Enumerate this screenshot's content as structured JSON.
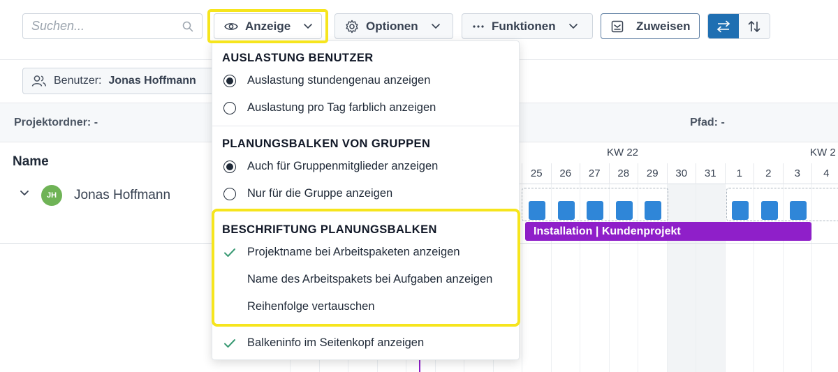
{
  "toolbar": {
    "search_placeholder": "Suchen...",
    "anzeige_label": "Anzeige",
    "optionen_label": "Optionen",
    "funktionen_label": "Funktionen",
    "zuweisen_label": "Zuweisen",
    "icons": {
      "search": "magnifier-icon",
      "anzeige": "eye-icon",
      "optionen": "gear-icon",
      "funktionen": "more-dots-icon",
      "zuweisen": "assign-inbox-icon",
      "horizontal": "swap-horizontal-icon",
      "vertical": "swap-vertical-icon"
    },
    "accent_color": "#1f6fb2"
  },
  "filter": {
    "label": "Benutzer:",
    "value": "Jonas Hoffmann"
  },
  "info": {
    "project_folder": "Projektordner: -",
    "path": "Pfad: -"
  },
  "table": {
    "name_header": "Name",
    "user": {
      "initials": "JH",
      "name": "Jonas Hoffmann",
      "avatar_color": "#6fb356"
    }
  },
  "gantt": {
    "weeks": [
      "KW 22",
      "KW 2"
    ],
    "days": [
      "25",
      "26",
      "27",
      "28",
      "29",
      "30",
      "31",
      "1",
      "2",
      "3",
      "4"
    ],
    "bar_label": "Installation | Kundenprojekt",
    "bar_color": "#8f1fc9",
    "chip_color": "#2f86d8"
  },
  "dropdown": {
    "section1": {
      "title": "AUSLASTUNG BENUTZER",
      "options": [
        {
          "label": "Auslastung stundengenau anzeigen",
          "selected": true
        },
        {
          "label": "Auslastung pro Tag farblich anzeigen",
          "selected": false
        }
      ]
    },
    "section2": {
      "title": "PLANUNGSBALKEN VON GRUPPEN",
      "options": [
        {
          "label": "Auch für Gruppenmitglieder anzeigen",
          "selected": true
        },
        {
          "label": "Nur für die Gruppe anzeigen",
          "selected": false
        }
      ]
    },
    "section3": {
      "title": "BESCHRIFTUNG PLANUNGSBALKEN",
      "options": [
        {
          "label": "Projektname bei Arbeitspaketen anzeigen",
          "checked": true
        },
        {
          "label": "Name des Arbeitspakets bei Aufgaben anzeigen",
          "checked": false
        },
        {
          "label": "Reihenfolge vertauschen",
          "checked": false
        }
      ]
    },
    "extra": {
      "label": "Balkeninfo im Seitenkopf anzeigen",
      "checked": true
    },
    "check_color": "#3a9a74",
    "highlight_color": "#f6e51d"
  }
}
